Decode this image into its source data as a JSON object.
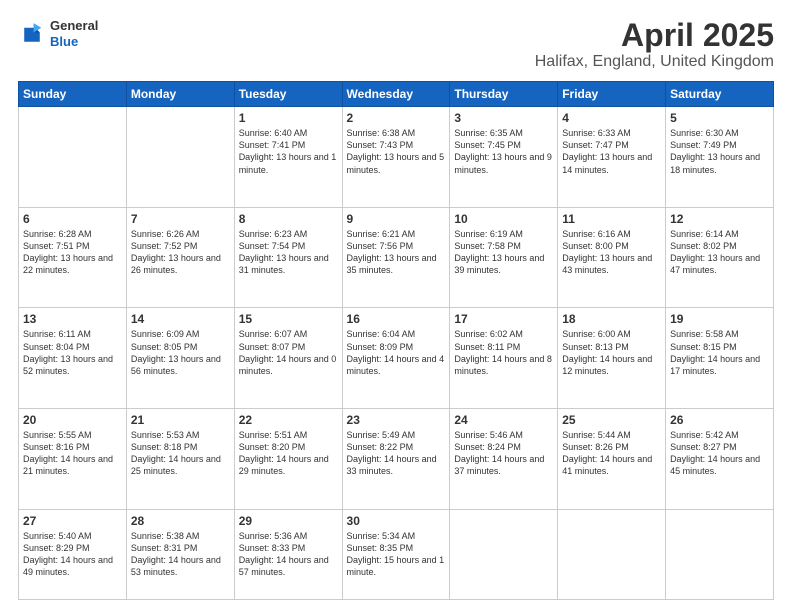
{
  "header": {
    "logo": {
      "general": "General",
      "blue": "Blue"
    },
    "title": "April 2025",
    "subtitle": "Halifax, England, United Kingdom"
  },
  "days_of_week": [
    "Sunday",
    "Monday",
    "Tuesday",
    "Wednesday",
    "Thursday",
    "Friday",
    "Saturday"
  ],
  "weeks": [
    [
      {
        "day": "",
        "info": ""
      },
      {
        "day": "",
        "info": ""
      },
      {
        "day": "1",
        "info": "Sunrise: 6:40 AM\nSunset: 7:41 PM\nDaylight: 13 hours\nand 1 minute."
      },
      {
        "day": "2",
        "info": "Sunrise: 6:38 AM\nSunset: 7:43 PM\nDaylight: 13 hours\nand 5 minutes."
      },
      {
        "day": "3",
        "info": "Sunrise: 6:35 AM\nSunset: 7:45 PM\nDaylight: 13 hours\nand 9 minutes."
      },
      {
        "day": "4",
        "info": "Sunrise: 6:33 AM\nSunset: 7:47 PM\nDaylight: 13 hours\nand 14 minutes."
      },
      {
        "day": "5",
        "info": "Sunrise: 6:30 AM\nSunset: 7:49 PM\nDaylight: 13 hours\nand 18 minutes."
      }
    ],
    [
      {
        "day": "6",
        "info": "Sunrise: 6:28 AM\nSunset: 7:51 PM\nDaylight: 13 hours\nand 22 minutes."
      },
      {
        "day": "7",
        "info": "Sunrise: 6:26 AM\nSunset: 7:52 PM\nDaylight: 13 hours\nand 26 minutes."
      },
      {
        "day": "8",
        "info": "Sunrise: 6:23 AM\nSunset: 7:54 PM\nDaylight: 13 hours\nand 31 minutes."
      },
      {
        "day": "9",
        "info": "Sunrise: 6:21 AM\nSunset: 7:56 PM\nDaylight: 13 hours\nand 35 minutes."
      },
      {
        "day": "10",
        "info": "Sunrise: 6:19 AM\nSunset: 7:58 PM\nDaylight: 13 hours\nand 39 minutes."
      },
      {
        "day": "11",
        "info": "Sunrise: 6:16 AM\nSunset: 8:00 PM\nDaylight: 13 hours\nand 43 minutes."
      },
      {
        "day": "12",
        "info": "Sunrise: 6:14 AM\nSunset: 8:02 PM\nDaylight: 13 hours\nand 47 minutes."
      }
    ],
    [
      {
        "day": "13",
        "info": "Sunrise: 6:11 AM\nSunset: 8:04 PM\nDaylight: 13 hours\nand 52 minutes."
      },
      {
        "day": "14",
        "info": "Sunrise: 6:09 AM\nSunset: 8:05 PM\nDaylight: 13 hours\nand 56 minutes."
      },
      {
        "day": "15",
        "info": "Sunrise: 6:07 AM\nSunset: 8:07 PM\nDaylight: 14 hours\nand 0 minutes."
      },
      {
        "day": "16",
        "info": "Sunrise: 6:04 AM\nSunset: 8:09 PM\nDaylight: 14 hours\nand 4 minutes."
      },
      {
        "day": "17",
        "info": "Sunrise: 6:02 AM\nSunset: 8:11 PM\nDaylight: 14 hours\nand 8 minutes."
      },
      {
        "day": "18",
        "info": "Sunrise: 6:00 AM\nSunset: 8:13 PM\nDaylight: 14 hours\nand 12 minutes."
      },
      {
        "day": "19",
        "info": "Sunrise: 5:58 AM\nSunset: 8:15 PM\nDaylight: 14 hours\nand 17 minutes."
      }
    ],
    [
      {
        "day": "20",
        "info": "Sunrise: 5:55 AM\nSunset: 8:16 PM\nDaylight: 14 hours\nand 21 minutes."
      },
      {
        "day": "21",
        "info": "Sunrise: 5:53 AM\nSunset: 8:18 PM\nDaylight: 14 hours\nand 25 minutes."
      },
      {
        "day": "22",
        "info": "Sunrise: 5:51 AM\nSunset: 8:20 PM\nDaylight: 14 hours\nand 29 minutes."
      },
      {
        "day": "23",
        "info": "Sunrise: 5:49 AM\nSunset: 8:22 PM\nDaylight: 14 hours\nand 33 minutes."
      },
      {
        "day": "24",
        "info": "Sunrise: 5:46 AM\nSunset: 8:24 PM\nDaylight: 14 hours\nand 37 minutes."
      },
      {
        "day": "25",
        "info": "Sunrise: 5:44 AM\nSunset: 8:26 PM\nDaylight: 14 hours\nand 41 minutes."
      },
      {
        "day": "26",
        "info": "Sunrise: 5:42 AM\nSunset: 8:27 PM\nDaylight: 14 hours\nand 45 minutes."
      }
    ],
    [
      {
        "day": "27",
        "info": "Sunrise: 5:40 AM\nSunset: 8:29 PM\nDaylight: 14 hours\nand 49 minutes."
      },
      {
        "day": "28",
        "info": "Sunrise: 5:38 AM\nSunset: 8:31 PM\nDaylight: 14 hours\nand 53 minutes."
      },
      {
        "day": "29",
        "info": "Sunrise: 5:36 AM\nSunset: 8:33 PM\nDaylight: 14 hours\nand 57 minutes."
      },
      {
        "day": "30",
        "info": "Sunrise: 5:34 AM\nSunset: 8:35 PM\nDaylight: 15 hours\nand 1 minute."
      },
      {
        "day": "",
        "info": ""
      },
      {
        "day": "",
        "info": ""
      },
      {
        "day": "",
        "info": ""
      }
    ]
  ]
}
